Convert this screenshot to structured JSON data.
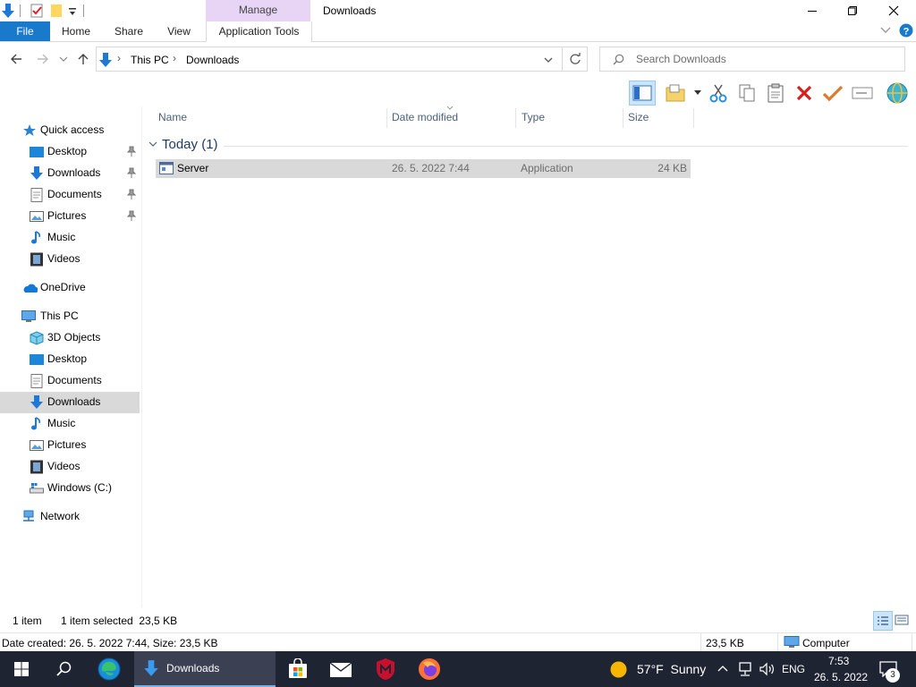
{
  "title_bar": {
    "context_tab": "Manage",
    "window_title": "Downloads"
  },
  "ribbon": {
    "tabs": [
      "File",
      "Home",
      "Share",
      "View",
      "Application Tools"
    ]
  },
  "address": {
    "crumbs": [
      "This PC",
      "Downloads"
    ]
  },
  "search": {
    "placeholder": "Search Downloads"
  },
  "sidebar": {
    "quick_access": "Quick access",
    "quick_items": [
      "Desktop",
      "Downloads",
      "Documents",
      "Pictures",
      "Music",
      "Videos"
    ],
    "onedrive": "OneDrive",
    "this_pc": "This PC",
    "pc_items": [
      "3D Objects",
      "Desktop",
      "Documents",
      "Downloads",
      "Music",
      "Pictures",
      "Videos",
      "Windows (C:)"
    ],
    "network": "Network"
  },
  "columns": {
    "name": "Name",
    "date": "Date modified",
    "type": "Type",
    "size": "Size"
  },
  "group": {
    "label": "Today (1)"
  },
  "files": [
    {
      "name": "Server",
      "date": "26. 5. 2022 7:44",
      "type": "Application",
      "size": "24 KB"
    }
  ],
  "status": {
    "count": "1 item",
    "selected": "1 item selected  23,5 KB"
  },
  "details": {
    "info": "Date created: 26. 5. 2022 7:44, Size: 23,5 KB",
    "size": "23,5 KB",
    "location": "Computer"
  },
  "taskbar": {
    "active_window": "Downloads",
    "weather": "57°F  Sunny",
    "lang": "ENG",
    "time": "7:53",
    "date": "26. 5. 2022",
    "notifications": "3"
  },
  "colors": {
    "file_tab": "#1979ca",
    "manage_tab": "#e8d5f5",
    "selection": "#d9d9d9",
    "taskbar": "#1f2433"
  }
}
